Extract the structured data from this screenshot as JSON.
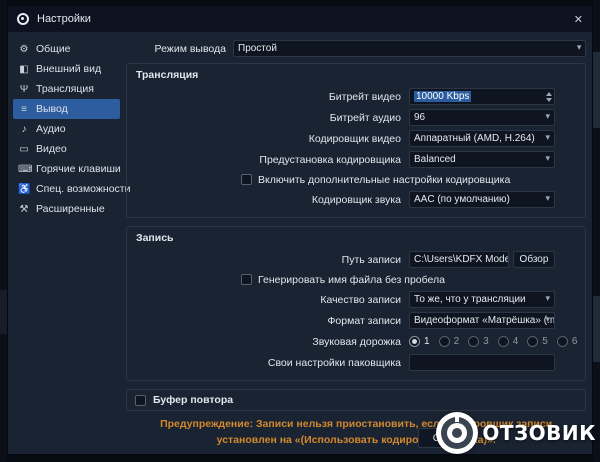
{
  "window": {
    "title": "Настройки",
    "close_glyph": "✕"
  },
  "icons": {
    "chevron_down": "▾"
  },
  "colors": {
    "accent_selected": "#2d5d9f",
    "selection_highlight": "#2a5c9f",
    "warning_text": "#d1882e",
    "dialog_bg": "#1a2331"
  },
  "sidebar": {
    "items": [
      {
        "label": "Общие",
        "icon": "gear",
        "glyph": "⚙"
      },
      {
        "label": "Внешний вид",
        "icon": "appearance",
        "glyph": "◧"
      },
      {
        "label": "Трансляция",
        "icon": "broadcast",
        "glyph": "Ψ"
      },
      {
        "label": "Вывод",
        "icon": "output",
        "glyph": "≡",
        "selected": true
      },
      {
        "label": "Аудио",
        "icon": "speaker",
        "glyph": "♪"
      },
      {
        "label": "Видео",
        "icon": "monitor",
        "glyph": "▭"
      },
      {
        "label": "Горячие клавиши",
        "icon": "keyboard",
        "glyph": "⌨"
      },
      {
        "label": "Спец. возможности",
        "icon": "accessibility",
        "glyph": "♿"
      },
      {
        "label": "Расширенные",
        "icon": "tools",
        "glyph": "⚒"
      }
    ]
  },
  "output_mode": {
    "label": "Режим вывода",
    "value": "Простой"
  },
  "streaming": {
    "title": "Трансляция",
    "video_bitrate": {
      "label": "Битрейт видео",
      "value": "10000 Kbps"
    },
    "audio_bitrate": {
      "label": "Битрейт аудио",
      "value": "96"
    },
    "video_encoder": {
      "label": "Кодировщик видео",
      "value": "Аппаратный (AMD, H.264)"
    },
    "encoder_preset": {
      "label": "Предустановка кодировщика",
      "value": "Balanced"
    },
    "advanced_checkbox": {
      "label": "Включить дополнительные настройки кодировщика",
      "checked": false
    },
    "audio_encoder": {
      "label": "Кодировщик звука",
      "value": "AAC (по умолчанию)"
    }
  },
  "recording": {
    "title": "Запись",
    "path": {
      "label": "Путь записи",
      "value": "C:\\Users\\KDFX Modes\\Videos",
      "browse_label": "Обзор"
    },
    "no_space_checkbox": {
      "label": "Генерировать имя файла без пробела",
      "checked": false
    },
    "quality": {
      "label": "Качество записи",
      "value": "То же, что у трансляции"
    },
    "format": {
      "label": "Формат записи",
      "value": "Видеоформат «Матрёшка» (.mkv)"
    },
    "audio_track": {
      "label": "Звуковая дорожка",
      "options": [
        "1",
        "2",
        "3",
        "4",
        "5",
        "6"
      ],
      "selected": "1"
    },
    "muxer": {
      "label": "Свои настройки паковщика",
      "value": ""
    }
  },
  "replay_buffer": {
    "label": "Буфер повтора",
    "checked": false
  },
  "warning": "Предупреждение: Записи нельзя приостановить, если кодировщик записи установлен на «(Использовать кодировщик потока)».",
  "buttons": {
    "ok": "ОК"
  },
  "watermark": {
    "text": "ОТЗОВИК"
  }
}
